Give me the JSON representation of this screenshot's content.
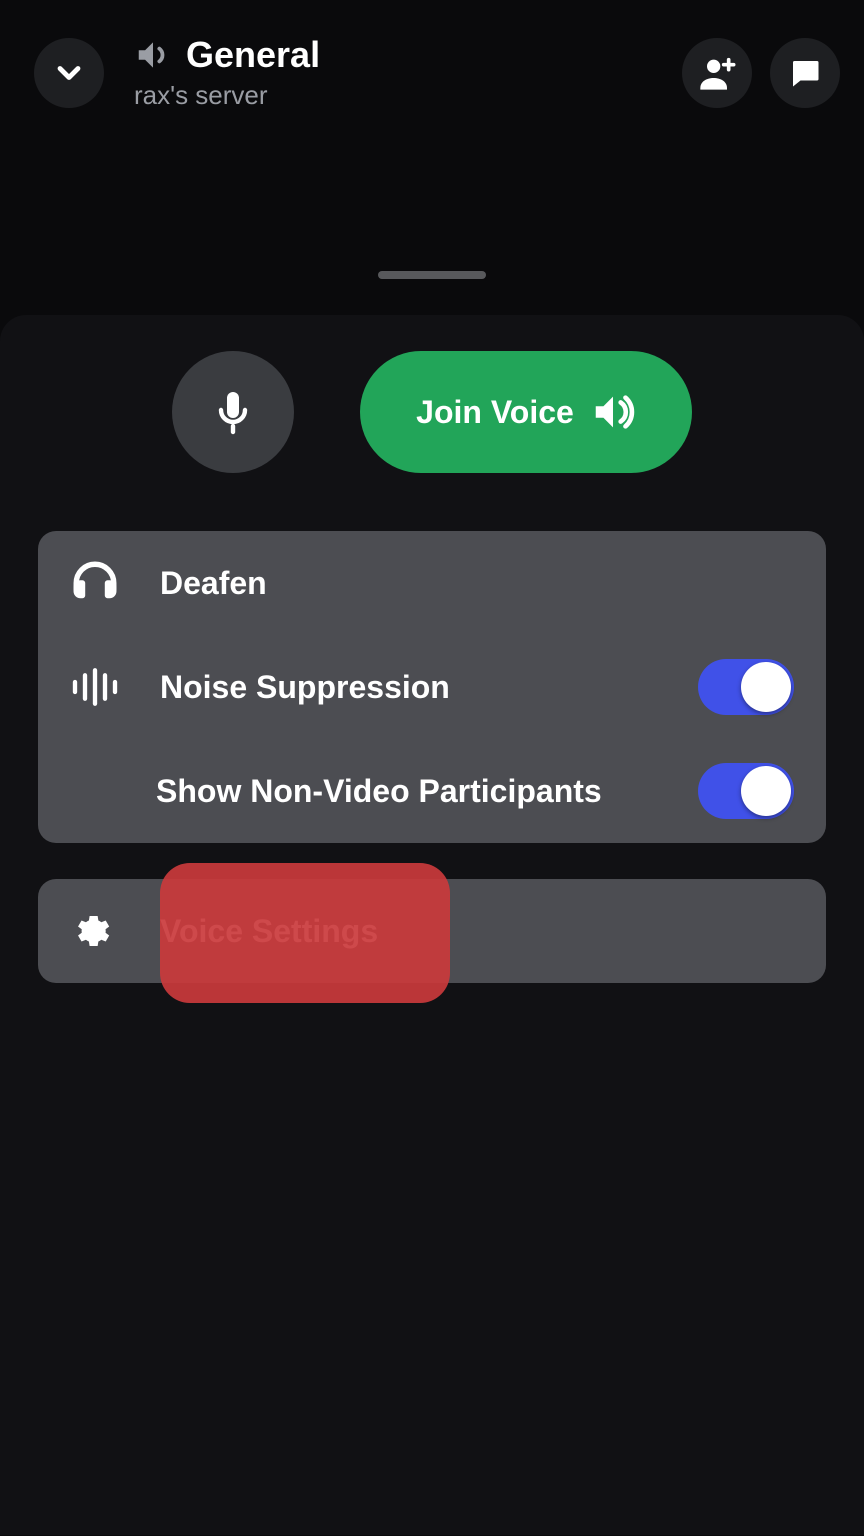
{
  "header": {
    "channel_name": "General",
    "server_name": "rax's server"
  },
  "actions": {
    "join_label": "Join Voice"
  },
  "options": {
    "deafen_label": "Deafen",
    "noise_label": "Noise Suppression",
    "nonvideo_label": "Show Non-Video Participants",
    "noise_on": true,
    "nonvideo_on": true
  },
  "settings": {
    "voice_settings_label": "Voice Settings"
  }
}
